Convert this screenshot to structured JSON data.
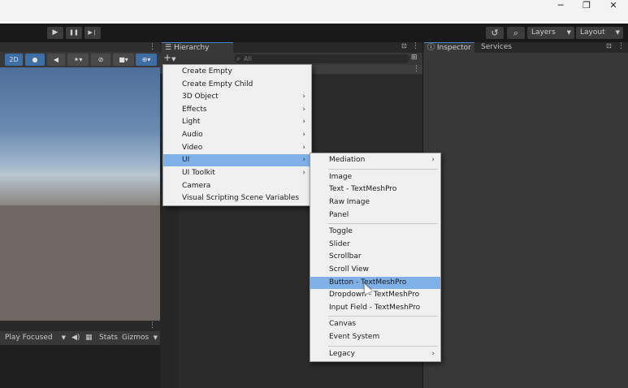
{
  "window": {
    "minimize_icon": "─",
    "restore_icon": "❐",
    "close_icon": "✕"
  },
  "toolbar": {
    "play_icon": "▶",
    "pause_icon": "❚❚",
    "step_icon": "▶❘",
    "history_icon": "↺",
    "search_icon": "⌕",
    "layers_label": "Layers",
    "layout_label": "Layout"
  },
  "scene_toolbar": {
    "mode_2d": "2D",
    "light_icon": "💡",
    "audio_icon": "🔈",
    "fx_icon": "✶",
    "hidden_icon": "⊘",
    "camera_icon": "■",
    "gizmo_icon": "⊕"
  },
  "game_toolbar": {
    "play_focused": "Play Focused",
    "mute_icon": "🔊",
    "stats_icon": "▦",
    "stats_label": "Stats",
    "gizmos_label": "Gizmos"
  },
  "hierarchy": {
    "tab_label": "Hierarchy",
    "add_icon": "+",
    "search_placeholder": "All",
    "lock_icon": "🔒",
    "menu_icon": "⋮"
  },
  "inspector": {
    "tab_label": "Inspector",
    "services_label": "Services",
    "lock_icon": "🔒",
    "menu_icon": "⋮"
  },
  "create_menu": [
    {
      "label": "Create Empty",
      "submenu": false
    },
    {
      "label": "Create Empty Child",
      "submenu": false
    },
    {
      "label": "3D Object",
      "submenu": true
    },
    {
      "label": "Effects",
      "submenu": true
    },
    {
      "label": "Light",
      "submenu": true
    },
    {
      "label": "Audio",
      "submenu": true
    },
    {
      "label": "Video",
      "submenu": true
    },
    {
      "label": "UI",
      "submenu": true,
      "highlighted": true
    },
    {
      "label": "UI Toolkit",
      "submenu": true
    },
    {
      "label": "Camera",
      "submenu": false
    },
    {
      "label": "Visual Scripting Scene Variables",
      "submenu": false
    }
  ],
  "ui_submenu": [
    {
      "label": "Mediation",
      "submenu": true
    },
    {
      "label": "Image"
    },
    {
      "label": "Text - TextMeshPro"
    },
    {
      "label": "Raw Image"
    },
    {
      "label": "Panel"
    },
    {
      "label": "Toggle"
    },
    {
      "label": "Slider"
    },
    {
      "label": "Scrollbar"
    },
    {
      "label": "Scroll View"
    },
    {
      "label": "Button - TextMeshPro",
      "highlighted": true
    },
    {
      "label": "Dropdown - TextMeshPro"
    },
    {
      "label": "Input Field - TextMeshPro"
    },
    {
      "label": "Canvas"
    },
    {
      "label": "Event System"
    },
    {
      "label": "Legacy",
      "submenu": true
    }
  ],
  "colors": {
    "highlight": "#7fb0e8",
    "menu_bg": "#f0f0f0",
    "panel_bg": "#383838",
    "accent": "#4d86c8"
  }
}
